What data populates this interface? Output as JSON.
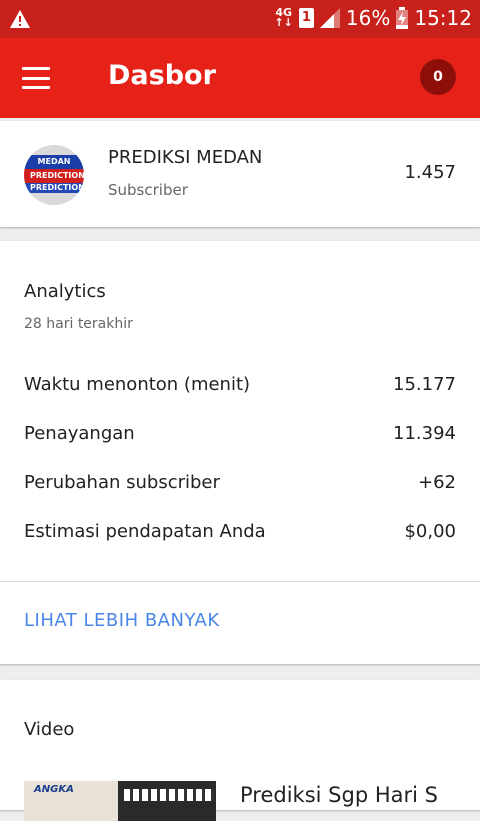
{
  "status_bar": {
    "network": "4G",
    "sim_slot": "1",
    "battery": "16%",
    "time": "15:12"
  },
  "app_bar": {
    "title": "Dasbor",
    "notification_count": "0"
  },
  "channel": {
    "name": "PREDIKSI MEDAN",
    "subscriber_label": "Subscriber",
    "subscriber_count": "1.457",
    "avatar_text_1": "MEDAN",
    "avatar_text_2": "PREDICTION",
    "avatar_text_3": "PREDICTION"
  },
  "analytics": {
    "title": "Analytics",
    "period": "28 hari terakhir",
    "metrics": [
      {
        "label": "Waktu menonton (menit)",
        "value": "15.177"
      },
      {
        "label": "Penayangan",
        "value": "11.394"
      },
      {
        "label": "Perubahan subscriber",
        "value": "+62"
      },
      {
        "label": "Estimasi pendapatan Anda",
        "value": "$0,00"
      }
    ],
    "more_link": "LIHAT LEBIH BANYAK"
  },
  "video": {
    "heading": "Video",
    "thumb_label": "ANGKA",
    "first_title": "Prediksi Sgp Hari S"
  },
  "colors": {
    "status_bar": "#c8201a",
    "app_bar": "#e62117",
    "link": "#4a86e8"
  }
}
